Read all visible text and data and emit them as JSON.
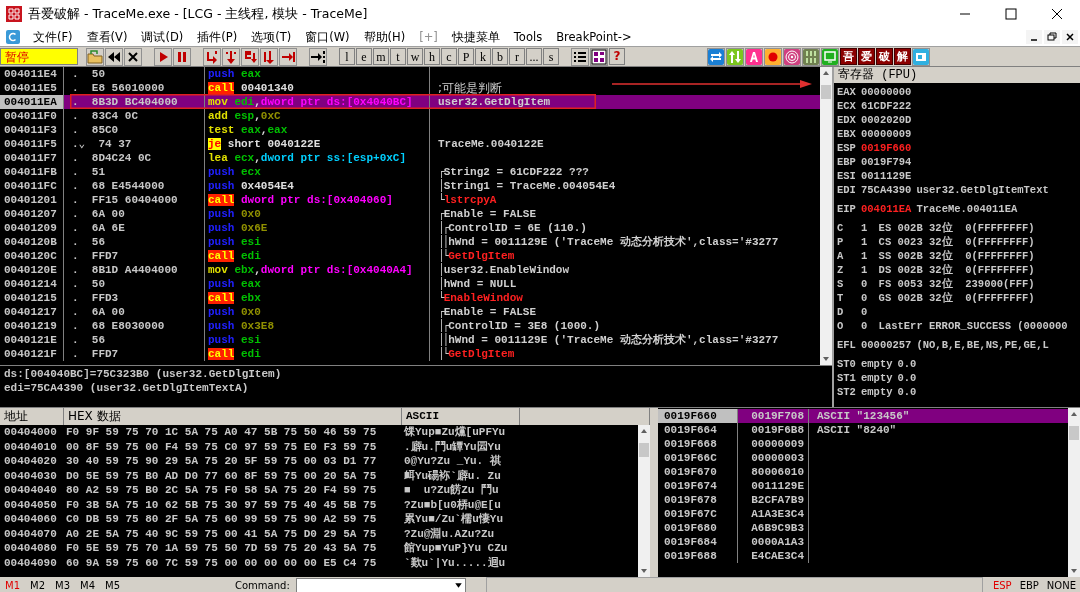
{
  "window": {
    "title": "吾爱破解 - TraceMe.exe - [LCG -  主线程, 模块 - TraceMe]"
  },
  "menu": [
    {
      "label": "文件(F)",
      "disabled": false
    },
    {
      "label": "查看(V)",
      "disabled": false
    },
    {
      "label": "调试(D)",
      "disabled": false
    },
    {
      "label": "插件(P)",
      "disabled": false
    },
    {
      "label": "选项(T)",
      "disabled": false
    },
    {
      "label": "窗口(W)",
      "disabled": false
    },
    {
      "label": "帮助(H)",
      "disabled": false
    },
    {
      "label": "[+]",
      "disabled": true
    },
    {
      "label": "快捷菜单",
      "disabled": false
    },
    {
      "label": "Tools",
      "disabled": false
    },
    {
      "label": "BreakPoint->",
      "disabled": false
    }
  ],
  "toolbar": {
    "status": "暂停",
    "groups": [
      [
        {
          "kind": "open"
        },
        {
          "kind": "rewind"
        },
        {
          "kind": "close"
        }
      ],
      [
        {
          "kind": "run"
        },
        {
          "kind": "pause"
        }
      ],
      [
        {
          "kind": "step_into"
        },
        {
          "kind": "step_over"
        },
        {
          "kind": "trace_into"
        },
        {
          "kind": "trace_over"
        },
        {
          "kind": "till_return"
        }
      ],
      [
        {
          "kind": "goto_line"
        }
      ],
      [
        {
          "kind": "letter",
          "text": "l"
        },
        {
          "kind": "letter",
          "text": "e"
        },
        {
          "kind": "letter",
          "text": "m"
        },
        {
          "kind": "letter",
          "text": "t"
        },
        {
          "kind": "letter",
          "text": "w"
        },
        {
          "kind": "letter",
          "text": "h"
        },
        {
          "kind": "letter",
          "text": "c"
        },
        {
          "kind": "letter",
          "text": "P"
        },
        {
          "kind": "letter",
          "text": "k"
        },
        {
          "kind": "letter",
          "text": "b"
        },
        {
          "kind": "letter",
          "text": "r"
        },
        {
          "kind": "letter",
          "text": "..."
        },
        {
          "kind": "letter",
          "text": "s"
        }
      ],
      [
        {
          "kind": "list"
        },
        {
          "kind": "windows_grid"
        },
        {
          "kind": "help",
          "text": "?"
        }
      ],
      [
        {
          "kind": "swap"
        },
        {
          "kind": "updown"
        },
        {
          "kind": "font_a"
        },
        {
          "kind": "record"
        },
        {
          "kind": "target"
        },
        {
          "kind": "binary"
        },
        {
          "kind": "screen"
        },
        {
          "kind": "char",
          "text": "吾"
        },
        {
          "kind": "char",
          "text": "爱"
        },
        {
          "kind": "char",
          "text": "破"
        },
        {
          "kind": "char",
          "text": "解"
        },
        {
          "kind": "window"
        }
      ]
    ]
  },
  "disassembly": [
    {
      "address": "004011E4",
      "marker": ".",
      "hex": "50",
      "mnemonic": "push",
      "kind": "push",
      "operands": [
        {
          "kind": "reg",
          "text": "eax"
        }
      ],
      "selected": false,
      "current": false
    },
    {
      "address": "004011E5",
      "marker": ".",
      "hex": "E8 56010000",
      "mnemonic": "call",
      "kind": "call",
      "operands": [
        {
          "kind": "addr",
          "text": "00401340"
        }
      ],
      "comment": {
        "text": ";可能是判断",
        "kind": "user"
      },
      "selected": false,
      "current": false
    },
    {
      "address": "004011EA",
      "marker": ".",
      "hex": "8B3D BC404000",
      "mnemonic": "mov",
      "kind": "move",
      "operands": [
        {
          "kind": "reg",
          "text": "edi"
        },
        {
          "kind": "plain",
          "text": ","
        },
        {
          "kind": "mem",
          "text": "dword ptr ds:[0x4040BC]"
        }
      ],
      "comment": {
        "text": "user32.GetDlgItem",
        "kind": "plain"
      },
      "selected": true,
      "current": true
    },
    {
      "address": "004011F0",
      "marker": ".",
      "hex": "83C4 0C",
      "mnemonic": "add",
      "kind": "move",
      "operands": [
        {
          "kind": "reg",
          "text": "esp"
        },
        {
          "kind": "plain",
          "text": ","
        },
        {
          "kind": "imm",
          "text": "0xC"
        }
      ],
      "selected": false,
      "current": false
    },
    {
      "address": "004011F3",
      "marker": ".",
      "hex": "85C0",
      "mnemonic": "test",
      "kind": "move",
      "operands": [
        {
          "kind": "reg",
          "text": "eax"
        },
        {
          "kind": "plain",
          "text": ","
        },
        {
          "kind": "reg",
          "text": "eax"
        }
      ],
      "selected": false,
      "current": false
    },
    {
      "address": "004011F5",
      "marker": ".⌄",
      "hex": "74 37",
      "mnemonic": "je",
      "kind": "jump",
      "operands": [
        {
          "kind": "addr",
          "text": "short 0040122E"
        }
      ],
      "comment": {
        "text": "TraceMe.0040122E",
        "kind": "plain"
      },
      "selected": false,
      "current": false
    },
    {
      "address": "004011F7",
      "marker": ".",
      "hex": "8D4C24 0C",
      "mnemonic": "lea",
      "kind": "move",
      "operands": [
        {
          "kind": "reg",
          "text": "ecx"
        },
        {
          "kind": "plain",
          "text": ","
        },
        {
          "kind": "stack",
          "text": "dword ptr ss:[esp+0xC]"
        }
      ],
      "selected": false,
      "current": false
    },
    {
      "address": "004011FB",
      "marker": ".",
      "hex": "51",
      "mnemonic": "push",
      "kind": "push",
      "operands": [
        {
          "kind": "reg",
          "text": "ecx"
        }
      ],
      "comment": {
        "text": "String2 = 61CDF222 ???",
        "kind": "plain",
        "brackets": "┌"
      },
      "selected": false,
      "current": false
    },
    {
      "address": "004011FC",
      "marker": ".",
      "hex": "68 E4544000",
      "mnemonic": "push",
      "kind": "push",
      "operands": [
        {
          "kind": "addr",
          "text": "0x4054E4"
        }
      ],
      "comment": {
        "text": "String1 = TraceMe.004054E4",
        "kind": "plain",
        "brackets": "│"
      },
      "selected": false,
      "current": false
    },
    {
      "address": "00401201",
      "marker": ".",
      "hex": "FF15 60404000",
      "mnemonic": "call",
      "kind": "call",
      "operands": [
        {
          "kind": "mem",
          "text": "dword ptr ds:[0x404060]"
        }
      ],
      "comment": {
        "text": "lstrcpyA",
        "kind": "api",
        "brackets": "└"
      },
      "selected": false,
      "current": false
    },
    {
      "address": "00401207",
      "marker": ".",
      "hex": "6A 00",
      "mnemonic": "push",
      "kind": "push",
      "operands": [
        {
          "kind": "imm",
          "text": "0x0"
        }
      ],
      "comment": {
        "text": "Enable = FALSE",
        "kind": "plain",
        "brackets": "┌"
      },
      "selected": false,
      "current": false
    },
    {
      "address": "00401209",
      "marker": ".",
      "hex": "6A 6E",
      "mnemonic": "push",
      "kind": "push",
      "operands": [
        {
          "kind": "imm",
          "text": "0x6E"
        }
      ],
      "comment": {
        "text": "ControlID = 6E (110.)",
        "kind": "plain",
        "brackets": "│┌"
      },
      "selected": false,
      "current": false
    },
    {
      "address": "0040120B",
      "marker": ".",
      "hex": "56",
      "mnemonic": "push",
      "kind": "push",
      "operands": [
        {
          "kind": "reg",
          "text": "esi"
        }
      ],
      "comment": {
        "text": "hWnd = 0011129E ('TraceMe 动态分析技术',class='#3277",
        "kind": "plain",
        "brackets": "││"
      },
      "selected": false,
      "current": false
    },
    {
      "address": "0040120C",
      "marker": ".",
      "hex": "FFD7",
      "mnemonic": "call",
      "kind": "call",
      "operands": [
        {
          "kind": "reg",
          "text": "edi"
        }
      ],
      "comment": {
        "text": "GetDlgItem",
        "kind": "api",
        "brackets": "│└"
      },
      "selected": false,
      "current": false
    },
    {
      "address": "0040120E",
      "marker": ".",
      "hex": "8B1D A4404000",
      "mnemonic": "mov",
      "kind": "move",
      "operands": [
        {
          "kind": "reg",
          "text": "ebx"
        },
        {
          "kind": "plain",
          "text": ","
        },
        {
          "kind": "mem",
          "text": "dword ptr ds:[0x4040A4]"
        }
      ],
      "comment": {
        "text": "user32.EnableWindow",
        "kind": "plain",
        "brackets": "│"
      },
      "selected": false,
      "current": false
    },
    {
      "address": "00401214",
      "marker": ".",
      "hex": "50",
      "mnemonic": "push",
      "kind": "push",
      "operands": [
        {
          "kind": "reg",
          "text": "eax"
        }
      ],
      "comment": {
        "text": "hWnd = NULL",
        "kind": "plain",
        "brackets": "│"
      },
      "selected": false,
      "current": false
    },
    {
      "address": "00401215",
      "marker": ".",
      "hex": "FFD3",
      "mnemonic": "call",
      "kind": "call",
      "operands": [
        {
          "kind": "reg",
          "text": "ebx"
        }
      ],
      "comment": {
        "text": "EnableWindow",
        "kind": "api",
        "brackets": "└"
      },
      "selected": false,
      "current": false
    },
    {
      "address": "00401217",
      "marker": ".",
      "hex": "6A 00",
      "mnemonic": "push",
      "kind": "push",
      "operands": [
        {
          "kind": "imm",
          "text": "0x0"
        }
      ],
      "comment": {
        "text": "Enable = FALSE",
        "kind": "plain",
        "brackets": "┌"
      },
      "selected": false,
      "current": false
    },
    {
      "address": "00401219",
      "marker": ".",
      "hex": "68 E8030000",
      "mnemonic": "push",
      "kind": "push",
      "operands": [
        {
          "kind": "imm",
          "text": "0x3E8"
        }
      ],
      "comment": {
        "text": "ControlID = 3E8 (1000.)",
        "kind": "plain",
        "brackets": "│┌"
      },
      "selected": false,
      "current": false
    },
    {
      "address": "0040121E",
      "marker": ".",
      "hex": "56",
      "mnemonic": "push",
      "kind": "push",
      "operands": [
        {
          "kind": "reg",
          "text": "esi"
        }
      ],
      "comment": {
        "text": "hWnd = 0011129E ('TraceMe 动态分析技术',class='#3277",
        "kind": "plain",
        "brackets": "││"
      },
      "selected": false,
      "current": false
    },
    {
      "address": "0040121F",
      "marker": ".",
      "hex": "FFD7",
      "mnemonic": "call",
      "kind": "call",
      "operands": [
        {
          "kind": "reg",
          "text": "edi"
        }
      ],
      "comment": {
        "text": "GetDlgItem",
        "kind": "api",
        "brackets": "│└"
      },
      "selected": false,
      "current": false
    }
  ],
  "info": [
    "ds:[004040BC]=75C323B0 (user32.GetDlgItem)",
    "edi=75CA4390 (user32.GetDlgItemTextA)"
  ],
  "registers": {
    "title": "寄存器 (FPU)",
    "groups": [
      [
        {
          "name": "EAX",
          "value": "00000000",
          "changed": false
        },
        {
          "name": "ECX",
          "value": "61CDF222",
          "changed": false
        },
        {
          "name": "EDX",
          "value": "0002020D",
          "changed": false
        },
        {
          "name": "EBX",
          "value": "00000009",
          "changed": false
        },
        {
          "name": "ESP",
          "value": "0019F660",
          "changed": true
        },
        {
          "name": "EBP",
          "value": "0019F794",
          "changed": false
        },
        {
          "name": "ESI",
          "value": "0011129E",
          "changed": false
        },
        {
          "name": "EDI",
          "value": "75CA4390",
          "note": "user32.GetDlgItemText",
          "changed": false
        }
      ],
      [
        {
          "name": "EIP",
          "value": "004011EA",
          "note": "TraceMe.004011EA",
          "changed": true
        }
      ],
      [
        {
          "name": "C",
          "value": "1",
          "note": " ES 002B 32位  0(FFFFFFFF)",
          "changed": false
        },
        {
          "name": "P",
          "value": "1",
          "note": " CS 0023 32位  0(FFFFFFFF)",
          "changed": false
        },
        {
          "name": "A",
          "value": "1",
          "note": " SS 002B 32位  0(FFFFFFFF)",
          "changed": false
        },
        {
          "name": "Z",
          "value": "1",
          "note": " DS 002B 32位  0(FFFFFFFF)",
          "changed": false
        },
        {
          "name": "S",
          "value": "0",
          "note": " FS 0053 32位  239000(FFF)",
          "changed": false
        },
        {
          "name": "T",
          "value": "0",
          "note": " GS 002B 32位  0(FFFFFFFF)",
          "changed": false
        },
        {
          "name": "D",
          "value": "0",
          "changed": false
        },
        {
          "name": "O",
          "value": "0",
          "note": " LastErr ERROR_SUCCESS (0000000",
          "changed": false
        }
      ],
      [
        {
          "name": "EFL",
          "value": "00000257",
          "note": "(NO,B,E,BE,NS,PE,GE,L",
          "changed": false
        }
      ],
      [
        {
          "name": "ST0",
          "value": "empty",
          "note": "0.0",
          "changed": false
        },
        {
          "name": "ST1",
          "value": "empty",
          "note": "0.0",
          "changed": false
        },
        {
          "name": "ST2",
          "value": "empty",
          "note": "0.0",
          "changed": false
        }
      ]
    ]
  },
  "dump": {
    "columns": [
      "地址",
      "HEX 数据",
      "ASCII"
    ],
    "rows": [
      {
        "address": "00404000",
        "hex": "F0 9F 59 75 70 1C 5A 75 A0 47 5B 75 50 46 59 75",
        "ascii": "馃Yup■Zu爣[uPFYu"
      },
      {
        "address": "00404010",
        "hex": "00 8F 59 75 00 F4 59 75 C0 97 59 75 E0 F3 59 75",
        "ascii": ".廦u.鬥u罈Yu囩Yu"
      },
      {
        "address": "00404020",
        "hex": "30 40 59 75 90 29 5A 75 20 5F 59 75 00 03 D1 77",
        "ascii": "0@Yu?Zu _Yu. 祺"
      },
      {
        "address": "00404030",
        "hex": "D0 5E 59 75 B0 AD D0 77 60 8F 59 75 00 20 5A 75",
        "ascii": "衈Yu碭袮`廦u. Zu"
      },
      {
        "address": "00404040",
        "hex": "80 A2 59 75 B0 2C 5A 75 F0 58 5A 75 20 F4 59 75",
        "ascii": "■  u?Zu餝Zu 鬥u"
      },
      {
        "address": "00404050",
        "hex": "F0 3B 5A 75 10 62 5B 75 30 97 59 75 40 45 5B 75",
        "ascii": "?Zu■b[u0梇u@E[u"
      },
      {
        "address": "00404060",
        "hex": "C0 DB 59 75 80 2F 5A 75 60 99 59 75 90 A2 59 75",
        "ascii": "累Yu■/Zu`檽u悽Yu"
      },
      {
        "address": "00404070",
        "hex": "A0 2E 5A 75 40 9C 59 75 00 41 5A 75 D0 29 5A 75",
        "ascii": "?Zu@淵u.AZu?Zu"
      },
      {
        "address": "00404080",
        "hex": "F0 5E 59 75 70 1A 59 75 50 7D 59 75 20 43 5A 75",
        "ascii": "館Yup■YuP}Yu CZu"
      },
      {
        "address": "00404090",
        "hex": "60 9A 59 75 60 7C 59 75 00 00 00 00 00 E5 C4 75",
        "ascii": "`歎u`|Yu.....迴u"
      }
    ]
  },
  "stack": [
    {
      "address": "0019F660",
      "value": "0019F708",
      "comment": "ASCII \"123456\"",
      "selected": true,
      "top": true
    },
    {
      "address": "0019F664",
      "value": "0019F6B8",
      "comment": "ASCII \"8240\"",
      "selected": false,
      "top": false
    },
    {
      "address": "0019F668",
      "value": "00000009",
      "selected": false,
      "top": false
    },
    {
      "address": "0019F66C",
      "value": "00000003",
      "selected": false,
      "top": false
    },
    {
      "address": "0019F670",
      "value": "80006010",
      "selected": false,
      "top": false
    },
    {
      "address": "0019F674",
      "value": "0011129E",
      "selected": false,
      "top": false
    },
    {
      "address": "0019F678",
      "value": "B2CFA7B9",
      "selected": false,
      "top": false
    },
    {
      "address": "0019F67C",
      "value": "A1A3E3C4",
      "selected": false,
      "top": false
    },
    {
      "address": "0019F680",
      "value": "A6B9C9B3",
      "selected": false,
      "top": false
    },
    {
      "address": "0019F684",
      "value": "0000A1A3",
      "selected": false,
      "top": false
    },
    {
      "address": "0019F688",
      "value": "E4CAE3C4",
      "selected": false,
      "top": false
    }
  ],
  "status_bar": {
    "memory_tabs": [
      {
        "label": "M1",
        "selected": true
      },
      {
        "label": "M2",
        "selected": false
      },
      {
        "label": "M3",
        "selected": false
      },
      {
        "label": "M4",
        "selected": false
      },
      {
        "label": "M5",
        "selected": false
      }
    ],
    "command_label": "Command:",
    "stack_modes": [
      {
        "label": "ESP",
        "selected": true
      },
      {
        "label": "EBP",
        "selected": false
      },
      {
        "label": "NONE",
        "selected": false
      }
    ]
  }
}
